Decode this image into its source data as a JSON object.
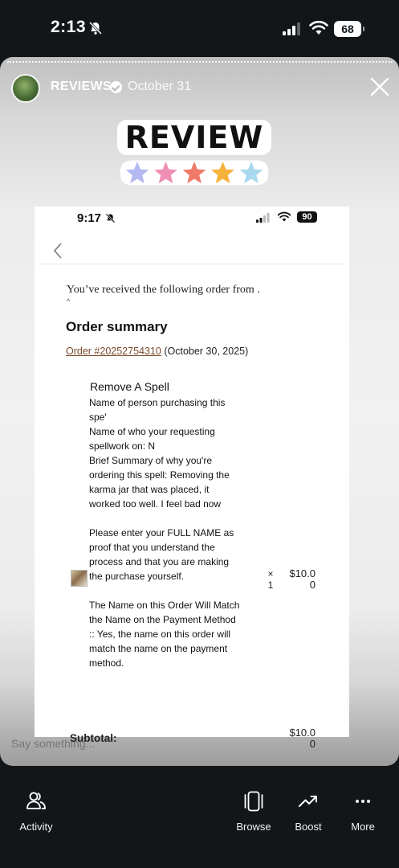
{
  "status_bar": {
    "time": "2:13",
    "battery": "68"
  },
  "story": {
    "username": "REVIEWS",
    "date": "October 31",
    "sticker_text": "REVIEW",
    "star_colors": [
      "#b3b8f0",
      "#f08fb5",
      "#f07a6a",
      "#f6b23d",
      "#a9d9ee"
    ],
    "reply_placeholder": "Say something..."
  },
  "inner": {
    "time": "9:17",
    "battery": "90",
    "intro": "You’ve received the following order from .",
    "heading": "Order summary",
    "order_link": "Order #20252754310",
    "order_date": " (October 30, 2025)",
    "product": "Remove A Spell",
    "details": [
      "Name of person purchasing this",
      "spe'",
      "Name of who your requesting",
      "spellwork on: N",
      "Brief Summary of why you're",
      "ordering this spell: Removing the",
      "karma jar that was placed, it",
      "worked too well. I feel bad now",
      "",
      "Please enter your FULL NAME as",
      "proof that you understand the",
      "process and that you are making",
      "the purchase yourself.",
      "",
      "The Name on this Order Will Match",
      "the Name on the Payment Method",
      ":: Yes, the name on this order will",
      "match the name on the payment",
      "method."
    ],
    "qty_x": "×",
    "qty": "1",
    "price_line1": "$10.0",
    "price_line2": "0",
    "subtotal_label": "Subtotal:",
    "subtotal_line1": "$10.0",
    "subtotal_line2": "0"
  },
  "nav": {
    "activity": "Activity",
    "browse": "Browse",
    "boost": "Boost",
    "more": "More"
  }
}
